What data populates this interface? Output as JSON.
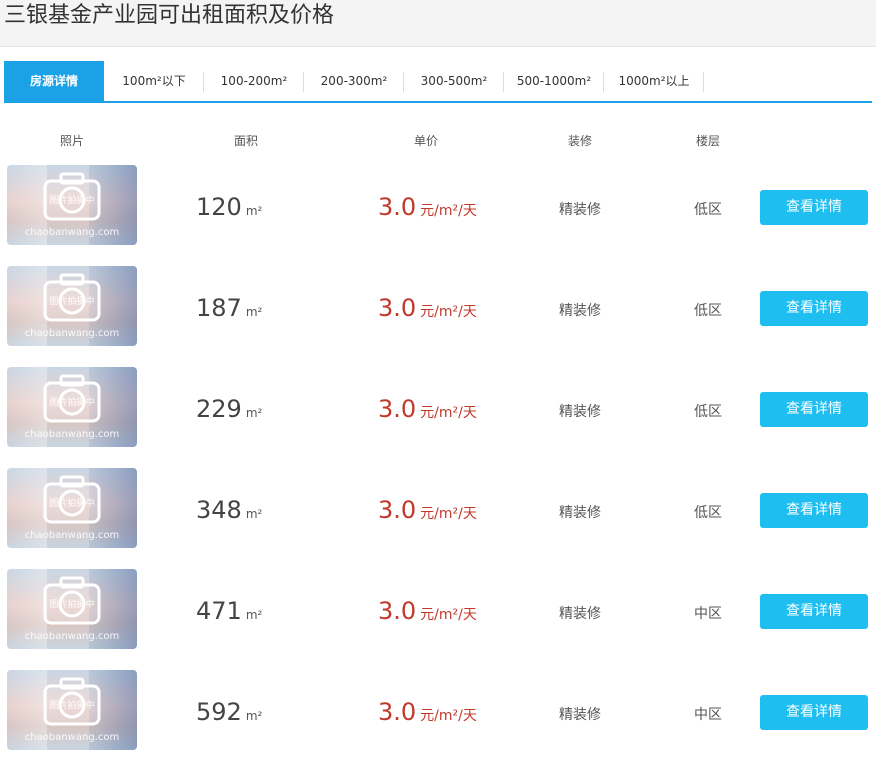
{
  "page": {
    "title": "三银基金产业园可出租面积及价格"
  },
  "tabs": [
    {
      "label": "房源详情"
    },
    {
      "label": "100m²以下"
    },
    {
      "label": "100-200m²"
    },
    {
      "label": "200-300m²"
    },
    {
      "label": "300-500m²"
    },
    {
      "label": "500-1000m²"
    },
    {
      "label": "1000m²以上"
    }
  ],
  "table": {
    "headers": {
      "photo": "照片",
      "area": "面积",
      "price": "单价",
      "decoration": "装修",
      "floor": "楼层"
    },
    "photo_overlay": {
      "label": "图片拍摄中",
      "watermark": "chaobanwang.com"
    },
    "rows": [
      {
        "area": "120",
        "area_unit": "m²",
        "price": "3.0",
        "price_unit": "元/m²/天",
        "decoration": "精装修",
        "floor": "低区",
        "button": "查看详情"
      },
      {
        "area": "187",
        "area_unit": "m²",
        "price": "3.0",
        "price_unit": "元/m²/天",
        "decoration": "精装修",
        "floor": "低区",
        "button": "查看详情"
      },
      {
        "area": "229",
        "area_unit": "m²",
        "price": "3.0",
        "price_unit": "元/m²/天",
        "decoration": "精装修",
        "floor": "低区",
        "button": "查看详情"
      },
      {
        "area": "348",
        "area_unit": "m²",
        "price": "3.0",
        "price_unit": "元/m²/天",
        "decoration": "精装修",
        "floor": "低区",
        "button": "查看详情"
      },
      {
        "area": "471",
        "area_unit": "m²",
        "price": "3.0",
        "price_unit": "元/m²/天",
        "decoration": "精装修",
        "floor": "中区",
        "button": "查看详情"
      },
      {
        "area": "592",
        "area_unit": "m²",
        "price": "3.0",
        "price_unit": "元/m²/天",
        "decoration": "精装修",
        "floor": "中区",
        "button": "查看详情"
      }
    ]
  },
  "colors": {
    "accent": "#1aa1e6",
    "button": "#1ebef0",
    "price": "#c0392b"
  }
}
